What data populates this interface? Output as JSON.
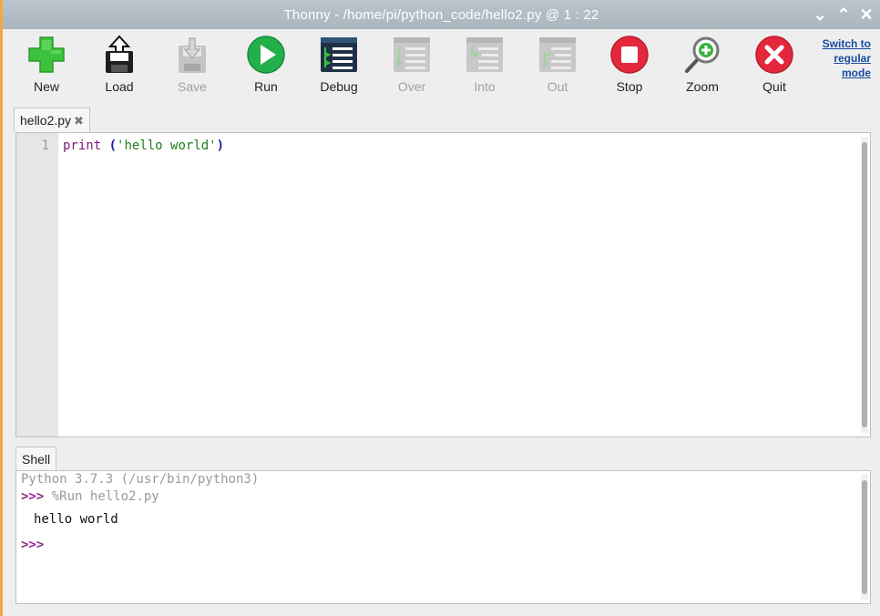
{
  "window": {
    "title": "Thonny  -  /home/pi/python_code/hello2.py  @  1 : 22",
    "controls": {
      "minimize": "⌄",
      "maximize": "⌃",
      "close": "✕"
    }
  },
  "toolbar": {
    "buttons": [
      {
        "id": "new",
        "label": "New",
        "icon": "new-icon",
        "enabled": true
      },
      {
        "id": "load",
        "label": "Load",
        "icon": "load-icon",
        "enabled": true
      },
      {
        "id": "save",
        "label": "Save",
        "icon": "save-icon",
        "enabled": false
      },
      {
        "id": "run",
        "label": "Run",
        "icon": "run-icon",
        "enabled": true
      },
      {
        "id": "debug",
        "label": "Debug",
        "icon": "debug-icon",
        "enabled": true
      },
      {
        "id": "over",
        "label": "Over",
        "icon": "step-over-icon",
        "enabled": false
      },
      {
        "id": "into",
        "label": "Into",
        "icon": "step-into-icon",
        "enabled": false
      },
      {
        "id": "out",
        "label": "Out",
        "icon": "step-out-icon",
        "enabled": false
      },
      {
        "id": "stop",
        "label": "Stop",
        "icon": "stop-icon",
        "enabled": true
      },
      {
        "id": "zoom",
        "label": "Zoom",
        "icon": "zoom-icon",
        "enabled": true
      },
      {
        "id": "quit",
        "label": "Quit",
        "icon": "quit-icon",
        "enabled": true
      }
    ],
    "switch_mode_lines": [
      "Switch to",
      "regular",
      "mode"
    ]
  },
  "editor": {
    "tab_label": "hello2.py",
    "tab_close": "✖",
    "line_number": "1",
    "code": {
      "keyword": "print",
      "open": "(",
      "string": "'hello world'",
      "close": ")"
    }
  },
  "shell": {
    "tab_label": "Shell",
    "banner": "Python 3.7.3 (/usr/bin/python3)",
    "prompt": ">>>",
    "command": "%Run hello2.py",
    "output": "hello world"
  },
  "colors": {
    "run_green": "#22b04b",
    "new_green": "#3cc23c",
    "stop_red": "#e3283c",
    "quit_red": "#e3283c",
    "link_blue": "#1a4aa5",
    "prompt_purple": "#8c2a8c"
  }
}
